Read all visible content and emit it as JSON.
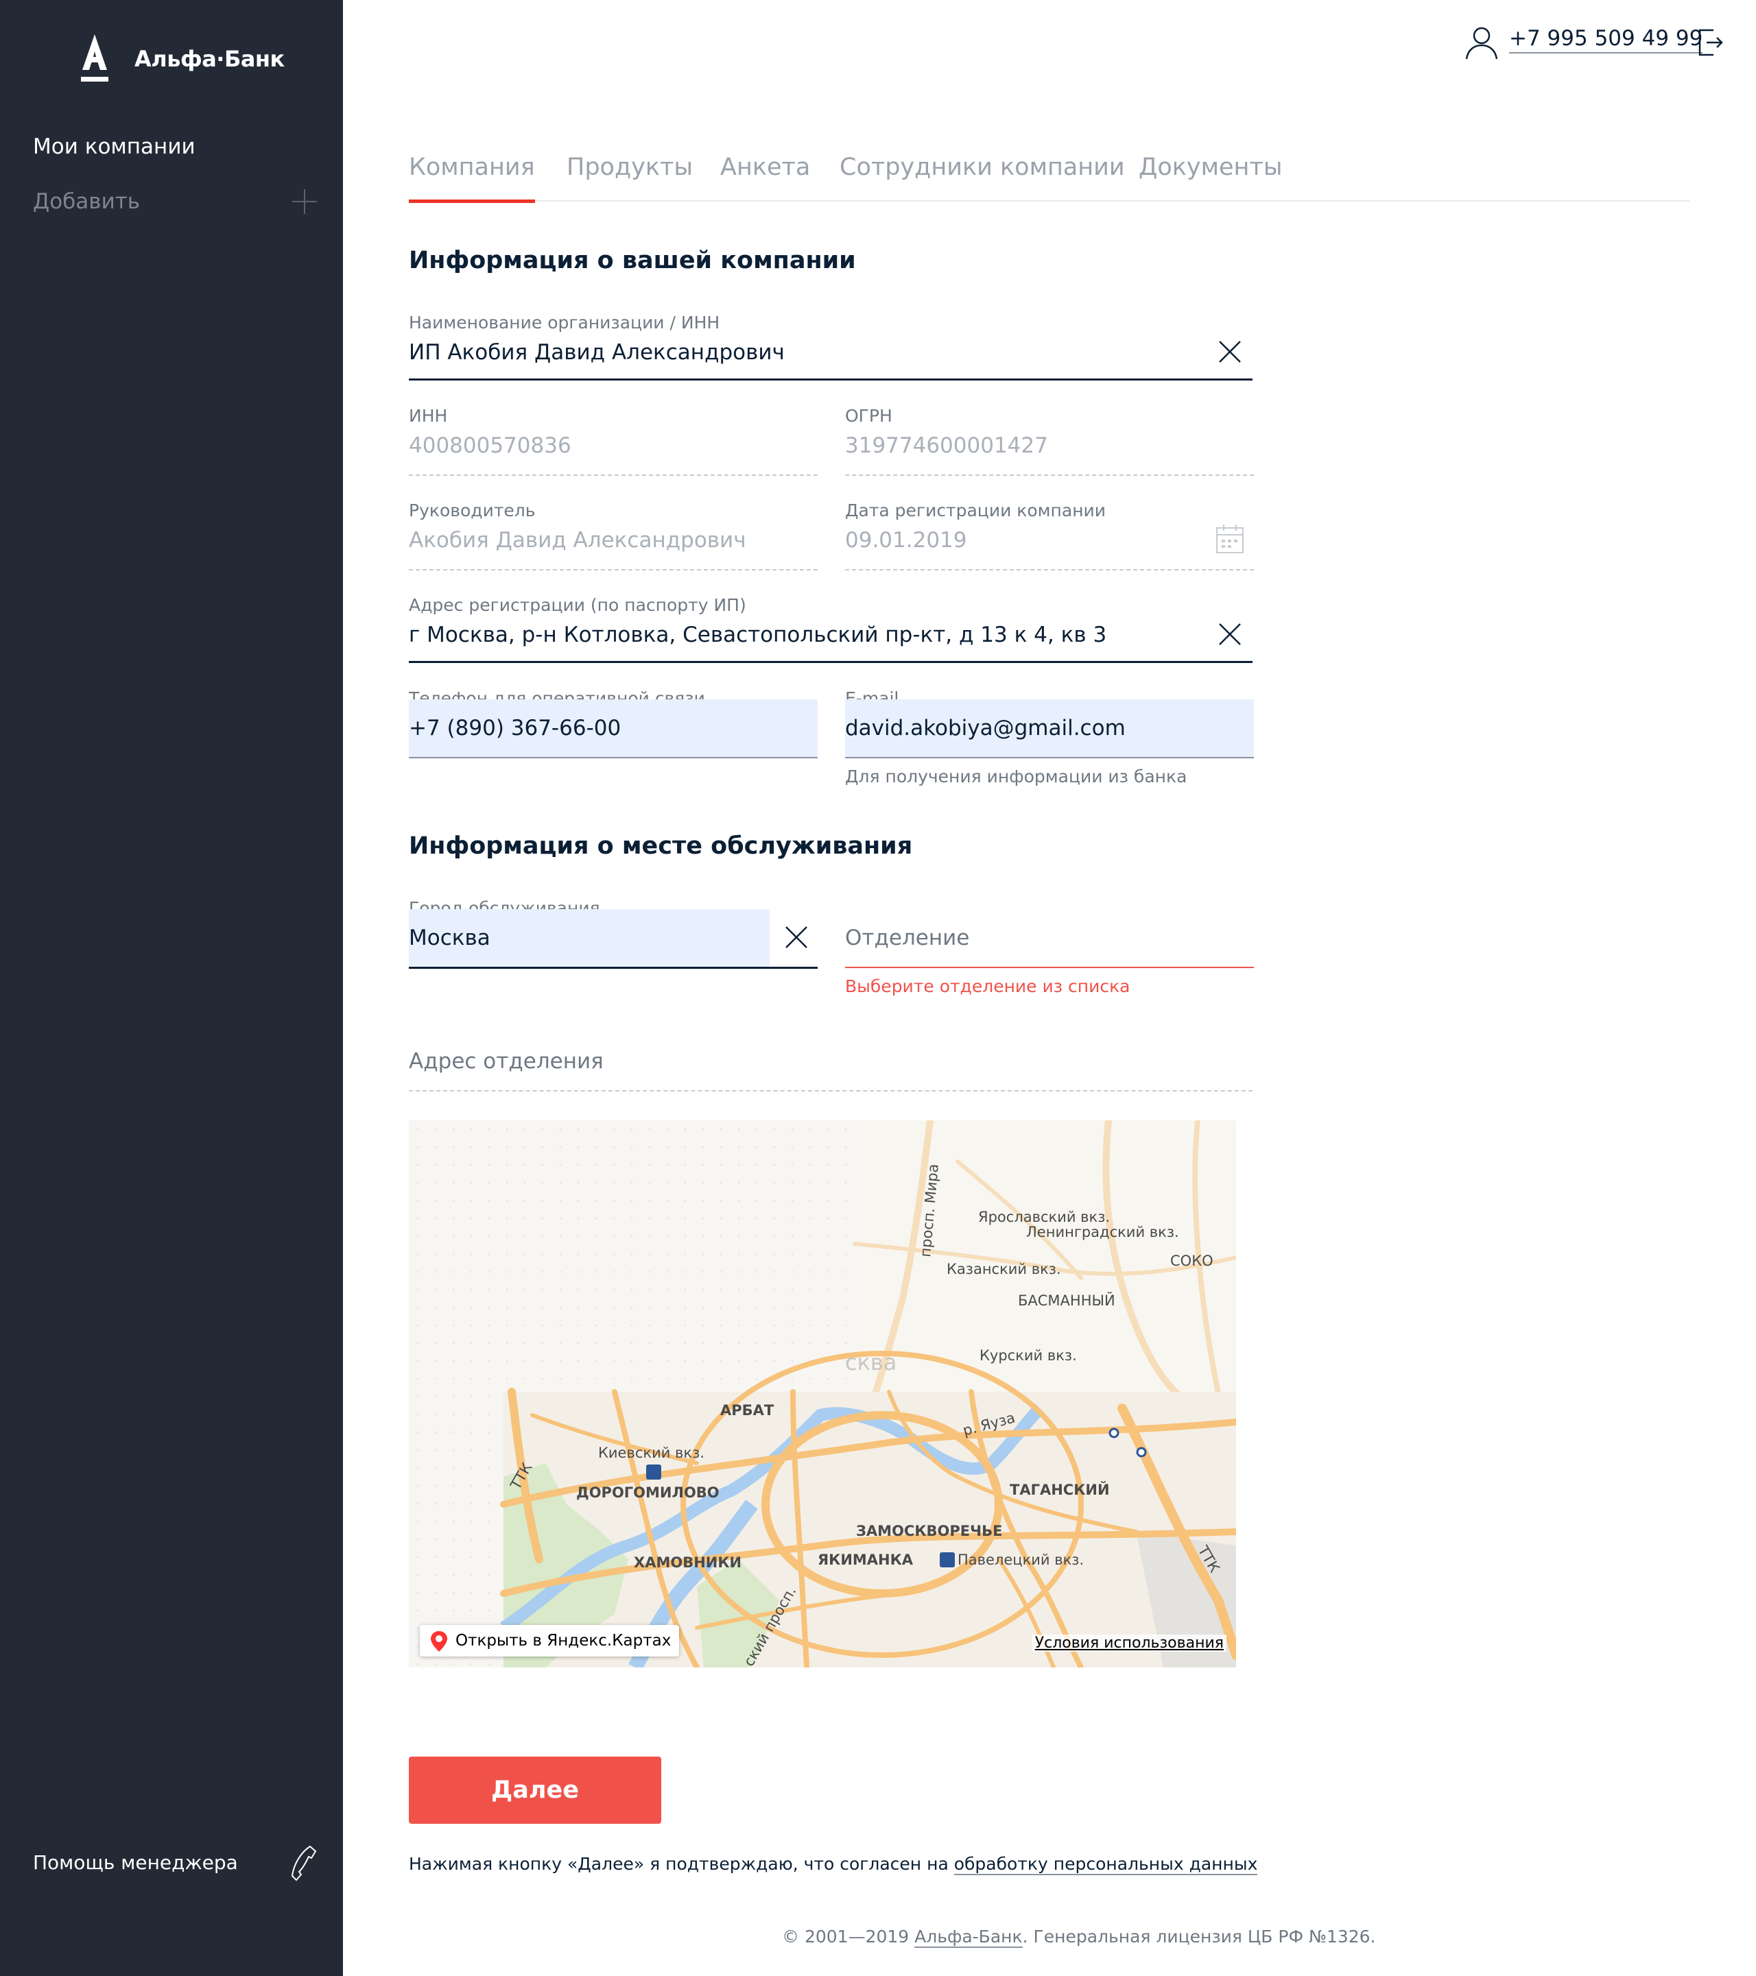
{
  "brand": {
    "name": "Альфа·Банк",
    "accent": "#ef3124",
    "sidebar_bg": "#232a35"
  },
  "sidebar": {
    "companies": "Мои компании",
    "add": "Добавить",
    "help": "Помощь менеджера",
    "icons": [
      "plus-icon",
      "phone-icon"
    ]
  },
  "header": {
    "phone": "+7 995 509 49 99",
    "icons": [
      "user-icon",
      "logout-icon"
    ]
  },
  "tabs": [
    {
      "label": "Компания",
      "active": true
    },
    {
      "label": "Продукты",
      "active": false
    },
    {
      "label": "Анкета",
      "active": false
    },
    {
      "label": "Сотрудники компании",
      "active": false
    },
    {
      "label": "Документы",
      "active": false
    }
  ],
  "company_section": {
    "title": "Информация о вашей компании",
    "org": {
      "label": "Наименование организации / ИНН",
      "value": "ИП Акобия Давид Александрович"
    },
    "inn": {
      "label": "ИНН",
      "value": "400800570836"
    },
    "ogrn": {
      "label": "ОГРН",
      "value": "319774600001427"
    },
    "head": {
      "label": "Руководитель",
      "value": "Акобия Давид Александрович"
    },
    "reg_date": {
      "label": "Дата регистрации компании",
      "value": "09.01.2019"
    },
    "address": {
      "label": "Адрес регистрации (по паспорту ИП)",
      "value": "г Москва, р-н Котловка, Севастопольский пр-кт, д 13 к 4, кв 3"
    },
    "phone": {
      "label": "Телефон для оперативной связи",
      "value": "+7 (890) 367-66-00"
    },
    "email": {
      "label": "E-mail",
      "value": "david.akobiya@gmail.com",
      "hint": "Для получения информации из банка"
    }
  },
  "service_section": {
    "title": "Информация о месте обслуживания",
    "city": {
      "label": "Город обслуживания",
      "value": "Москва"
    },
    "branch": {
      "placeholder": "Отделение",
      "error": "Выберите отделение из списка"
    },
    "branch_address": {
      "placeholder": "Адрес отделения"
    }
  },
  "map": {
    "open_label": "Открыть в Яндекс.Картах",
    "terms": "Условия использования",
    "labels": {
      "prosp_mira": "просп. Мира",
      "yaroslavsky": "Ярославский вкз.",
      "leningradsky": "Ленинградский вкз.",
      "kazansky": "Казанский вкз.",
      "basmanny": "БАСМАННЫЙ",
      "sokol": "СОКО",
      "kursky": "Курский вкз.",
      "moskva": "сква",
      "arbat": "АРБАТ",
      "kievsky": "Киевский вкз.",
      "dorogomilovo": "ДОРОГОМИЛОВО",
      "yauza": "р. Яуза",
      "tagansky": "ТАГАНСКИЙ",
      "zamoskvorechye": "ЗАМОСКВОРЕЧЬЕ",
      "khamovniki": "ХАМОВНИКИ",
      "yakimanka": "ЯКИМАНКА",
      "paveletsky": "Павелецкий вкз.",
      "ttk": "ТТК",
      "prosp": "ский просп."
    }
  },
  "submit_label": "Далее",
  "consent": {
    "text": "Нажимая кнопку «Далее» я подтверждаю, что согласен на ",
    "link": "обработку персональных данных"
  },
  "footer": {
    "prefix": "© 2001—2019 ",
    "link": "Альфа-Банк",
    "suffix": ". Генеральная лицензия ЦБ РФ №1326."
  }
}
